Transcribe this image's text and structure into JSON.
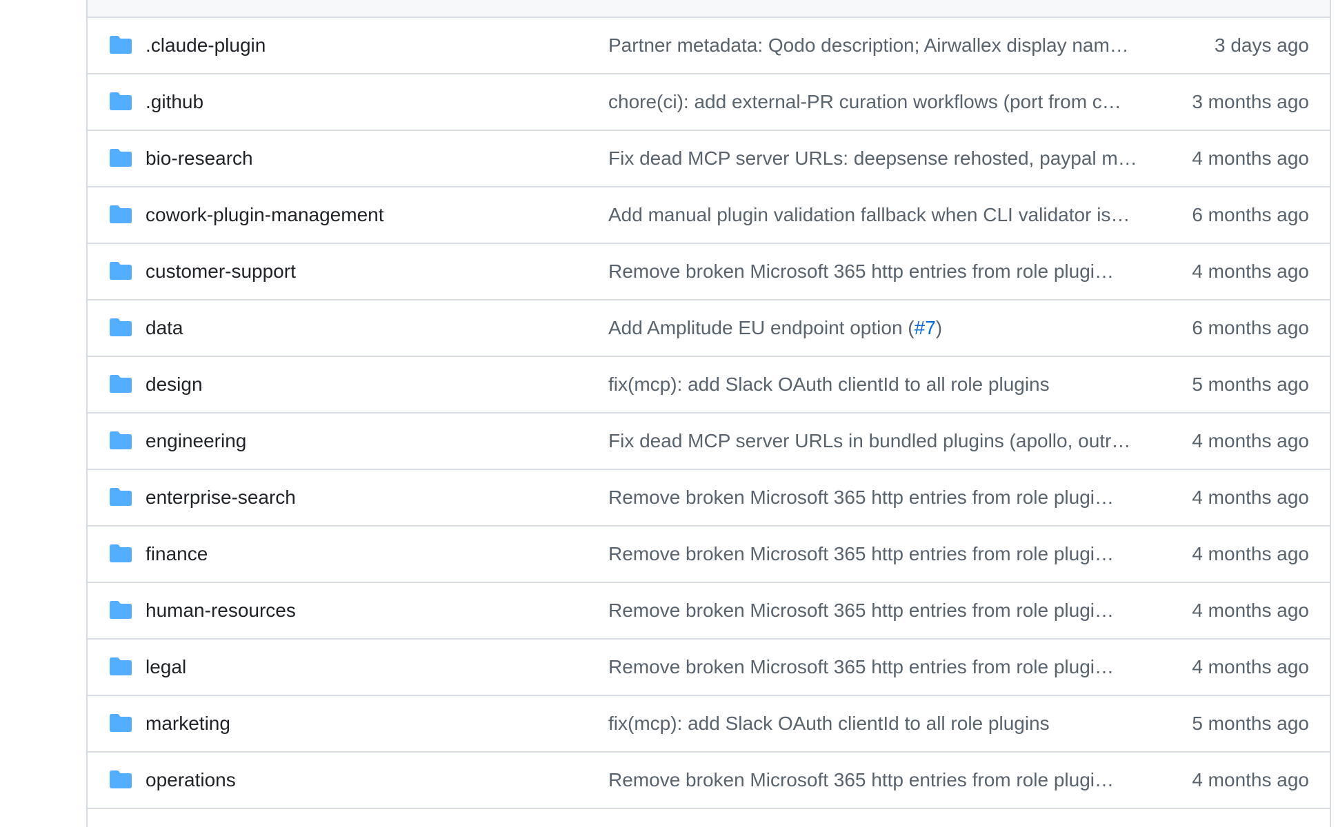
{
  "colors": {
    "folder_icon": "#54aeff",
    "row_border": "#d8dde3",
    "header_bg": "#f6f8fa",
    "name_text": "#1f2328",
    "muted_text": "#59636e",
    "link": "#0969da"
  },
  "file_list": {
    "rows": [
      {
        "icon": "folder-icon",
        "name": ".claude-plugin",
        "commit": "Partner metadata: Qodo description; Airwallex display nam…",
        "age": "3 days ago"
      },
      {
        "icon": "folder-icon",
        "name": ".github",
        "commit": "chore(ci): add external-PR curation workflows (port from c…",
        "age": "3 months ago"
      },
      {
        "icon": "folder-icon",
        "name": "bio-research",
        "commit": "Fix dead MCP server URLs: deepsense rehosted, paypal m…",
        "age": "4 months ago"
      },
      {
        "icon": "folder-icon",
        "name": "cowork-plugin-management",
        "commit": "Add manual plugin validation fallback when CLI validator is…",
        "age": "6 months ago"
      },
      {
        "icon": "folder-icon",
        "name": "customer-support",
        "commit": "Remove broken Microsoft 365 http entries from role plugi…",
        "age": "4 months ago"
      },
      {
        "icon": "folder-icon",
        "name": "data",
        "commit_prefix": "Add Amplitude EU endpoint option (",
        "commit_link": "#7",
        "commit_suffix": ")",
        "age": "6 months ago"
      },
      {
        "icon": "folder-icon",
        "name": "design",
        "commit": "fix(mcp): add Slack OAuth clientId to all role plugins",
        "age": "5 months ago"
      },
      {
        "icon": "folder-icon",
        "name": "engineering",
        "commit": "Fix dead MCP server URLs in bundled plugins (apollo, outr…",
        "age": "4 months ago"
      },
      {
        "icon": "folder-icon",
        "name": "enterprise-search",
        "commit": "Remove broken Microsoft 365 http entries from role plugi…",
        "age": "4 months ago"
      },
      {
        "icon": "folder-icon",
        "name": "finance",
        "commit": "Remove broken Microsoft 365 http entries from role plugi…",
        "age": "4 months ago"
      },
      {
        "icon": "folder-icon",
        "name": "human-resources",
        "commit": "Remove broken Microsoft 365 http entries from role plugi…",
        "age": "4 months ago"
      },
      {
        "icon": "folder-icon",
        "name": "legal",
        "commit": "Remove broken Microsoft 365 http entries from role plugi…",
        "age": "4 months ago"
      },
      {
        "icon": "folder-icon",
        "name": "marketing",
        "commit": "fix(mcp): add Slack OAuth clientId to all role plugins",
        "age": "5 months ago"
      },
      {
        "icon": "folder-icon",
        "name": "operations",
        "commit": "Remove broken Microsoft 365 http entries from role plugi…",
        "age": "4 months ago"
      }
    ]
  }
}
